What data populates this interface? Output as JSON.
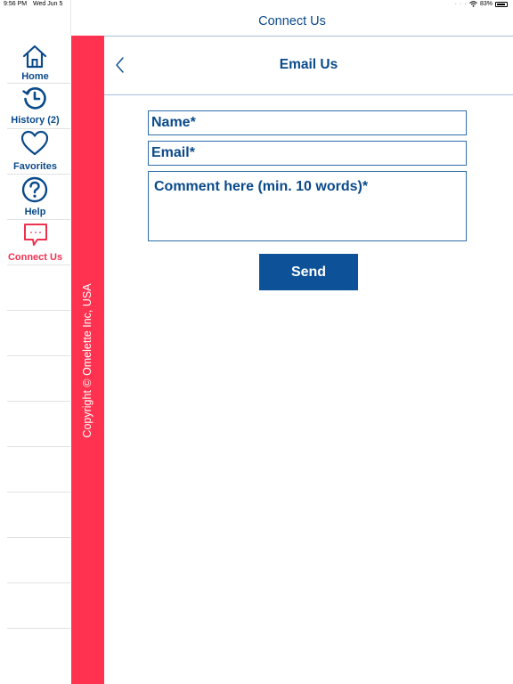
{
  "status_bar": {
    "time": "9:56 PM",
    "date": "Wed Jun 5",
    "battery": "83%"
  },
  "top_bar": {
    "title": "Connect Us"
  },
  "sidebar": {
    "items": [
      {
        "label": "Home",
        "icon": "home-icon"
      },
      {
        "label": "History (2)",
        "icon": "history-icon"
      },
      {
        "label": "Favorites",
        "icon": "heart-icon"
      },
      {
        "label": "Help",
        "icon": "help-icon"
      },
      {
        "label": "Connect Us",
        "icon": "chat-icon",
        "active": true
      }
    ]
  },
  "strip": {
    "copyright": "Copyright © Omelette Inc, USA"
  },
  "page": {
    "title": "Email Us",
    "form": {
      "name_placeholder": "Name*",
      "email_placeholder": "Email*",
      "comment_placeholder": "Comment here (min. 10 words)*",
      "send_label": "Send"
    }
  },
  "colors": {
    "accent": "#0a4a8a",
    "brand_red": "#ff3350",
    "button": "#0d5298"
  }
}
